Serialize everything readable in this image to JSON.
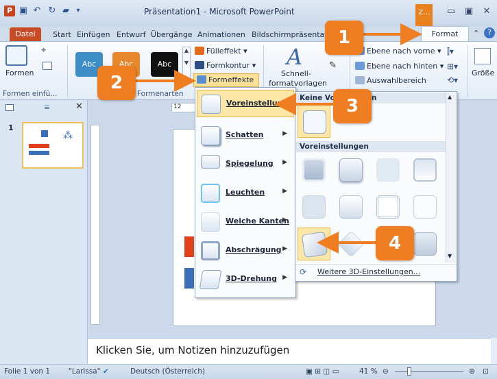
{
  "window": {
    "title": "Präsentation1 - Microsoft PowerPoint",
    "context_tab_header": "Z...",
    "controls": [
      "minimize",
      "restore",
      "close"
    ]
  },
  "tabs": [
    {
      "label": "Datei"
    },
    {
      "label": "Start"
    },
    {
      "label": "Einfügen"
    },
    {
      "label": "Entwurf"
    },
    {
      "label": "Übergänge"
    },
    {
      "label": "Animationen"
    },
    {
      "label": "Bildschirmpräsentat"
    },
    {
      "label": "Format"
    }
  ],
  "ribbon": {
    "group_insert_label": "Formen einfü...",
    "formen_label": "Formen",
    "styles_group_label": "Formenarten",
    "style_swatches": [
      {
        "label": "Abc",
        "color": "#3d8dc6"
      },
      {
        "label": "Abc",
        "color": "#e8882c"
      },
      {
        "label": "Abc",
        "color": "#111111"
      }
    ],
    "fill_label": "Fülleffekt",
    "outline_label": "Formkontur",
    "effects_label": "Formeffekte",
    "quick_styles_label1": "Schnell-",
    "quick_styles_label2": "formatvorlagen",
    "bring_forward": "Ebene nach vorne",
    "send_backward": "Ebene nach hinten",
    "selection_pane": "Auswahlbereich",
    "size_label": "Größe"
  },
  "slide_thumb_number": "1",
  "notes_placeholder": "Klicken Sie, um Notizen hinzuzufügen",
  "ruler_label": "12",
  "effects_menu": [
    {
      "label": "Voreinstellung",
      "has_submenu": false
    },
    {
      "label": "Schatten",
      "has_submenu": true
    },
    {
      "label": "Spiegelung",
      "has_submenu": true
    },
    {
      "label": "Leuchten",
      "has_submenu": true
    },
    {
      "label": "Weiche Kanten",
      "has_submenu": true
    },
    {
      "label": "Abschrägung",
      "has_submenu": true
    },
    {
      "label": "3D-Drehung",
      "has_submenu": true
    }
  ],
  "gallery": {
    "header_none": "Keine Vo",
    "header_none_suffix": "n",
    "header_presets": "Voreinstellungen",
    "more_label": "Weitere 3D-Einstellungen..."
  },
  "statusbar": {
    "slide_info": "Folie 1 von 1",
    "theme": "\"Larissa\"",
    "language": "Deutsch (Österreich)",
    "zoom": "41 %"
  },
  "callouts": [
    "1",
    "2",
    "3",
    "4"
  ],
  "colors": {
    "accent": "#ef7d22",
    "file_tab": "#c84b26",
    "highlight": "#fde7a8"
  }
}
